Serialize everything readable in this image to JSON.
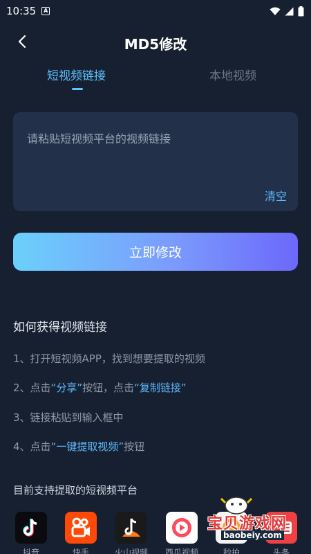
{
  "status_bar": {
    "time": "10:35",
    "notification_letter": "A"
  },
  "header": {
    "title": "MD5修改"
  },
  "tabs": [
    {
      "label": "短视频链接",
      "active": true
    },
    {
      "label": "本地视频",
      "active": false
    }
  ],
  "link_input": {
    "placeholder": "请粘贴短视频平台的视频链接",
    "value": "",
    "clear_label": "清空"
  },
  "action_button": {
    "label": "立即修改"
  },
  "howto": {
    "title": "如何获得视频链接",
    "steps": [
      {
        "prefix": "1、打开短视频APP，找到想要提取的视频"
      },
      {
        "prefix": "2、点击",
        "hl1": "“分享”",
        "mid": "按钮，点击",
        "hl2": "“复制链接”"
      },
      {
        "prefix": "3、链接粘贴到输入框中"
      },
      {
        "prefix": "4、点击",
        "hl1": "“一键提取视频”",
        "mid": "按钮"
      }
    ]
  },
  "platforms": {
    "title": "目前支持提取的短视频平台",
    "items": [
      {
        "name": "抖音",
        "icon": "douyin-icon"
      },
      {
        "name": "快手",
        "icon": "kuaishou-icon"
      },
      {
        "name": "火山视频",
        "icon": "huoshan-icon"
      },
      {
        "name": "西瓜视频",
        "icon": "xigua-icon"
      },
      {
        "name": "秒拍",
        "icon": "miaopai-icon"
      },
      {
        "name": "头条",
        "icon": "toutiao-icon"
      }
    ]
  },
  "watermark": {
    "text": "宝贝游戏网",
    "url": "baobeiy.com"
  },
  "colors": {
    "background": "#162030",
    "card": "#22304a",
    "accent": "#5fc3ff",
    "button_gradient_start": "#6bd0fb",
    "button_gradient_end": "#6c68fb"
  }
}
